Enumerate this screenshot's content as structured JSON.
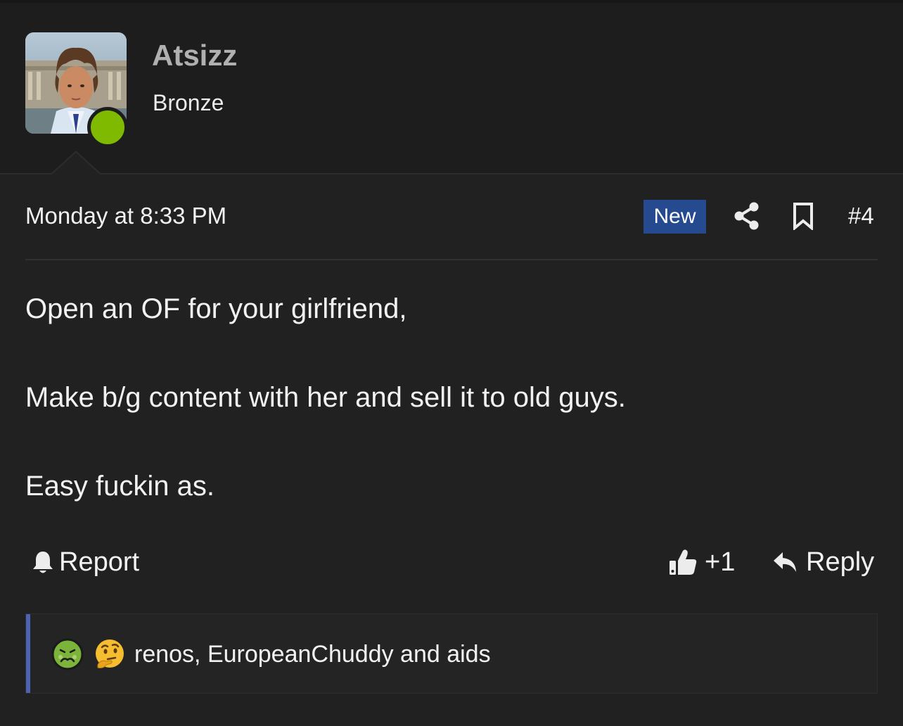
{
  "user": {
    "username": "Atsizz",
    "title": "Bronze",
    "online_status": "online",
    "online_color": "#7fba00"
  },
  "post": {
    "date": "Monday at 8:33 PM",
    "new_badge": "New",
    "number": "#4",
    "lines": [
      "Open an OF for your girlfriend,",
      "Make b/g content with her and sell it to old guys.",
      "Easy fuckin as."
    ]
  },
  "actions": {
    "report_label": "Report",
    "like_label": "+1",
    "reply_label": "Reply",
    "report_icon": "bell-icon",
    "like_icon": "thumbs-up-icon",
    "reply_icon": "reply-arrow-icon"
  },
  "reactions": {
    "icons": [
      "nauseated-face-icon",
      "thinking-face-icon"
    ],
    "text": "renos, EuropeanChuddy and aids",
    "accent_color": "#4b62b5"
  },
  "colors": {
    "background": "#212122",
    "header_background": "#1d1d1e",
    "badge_background": "#254a8f"
  }
}
